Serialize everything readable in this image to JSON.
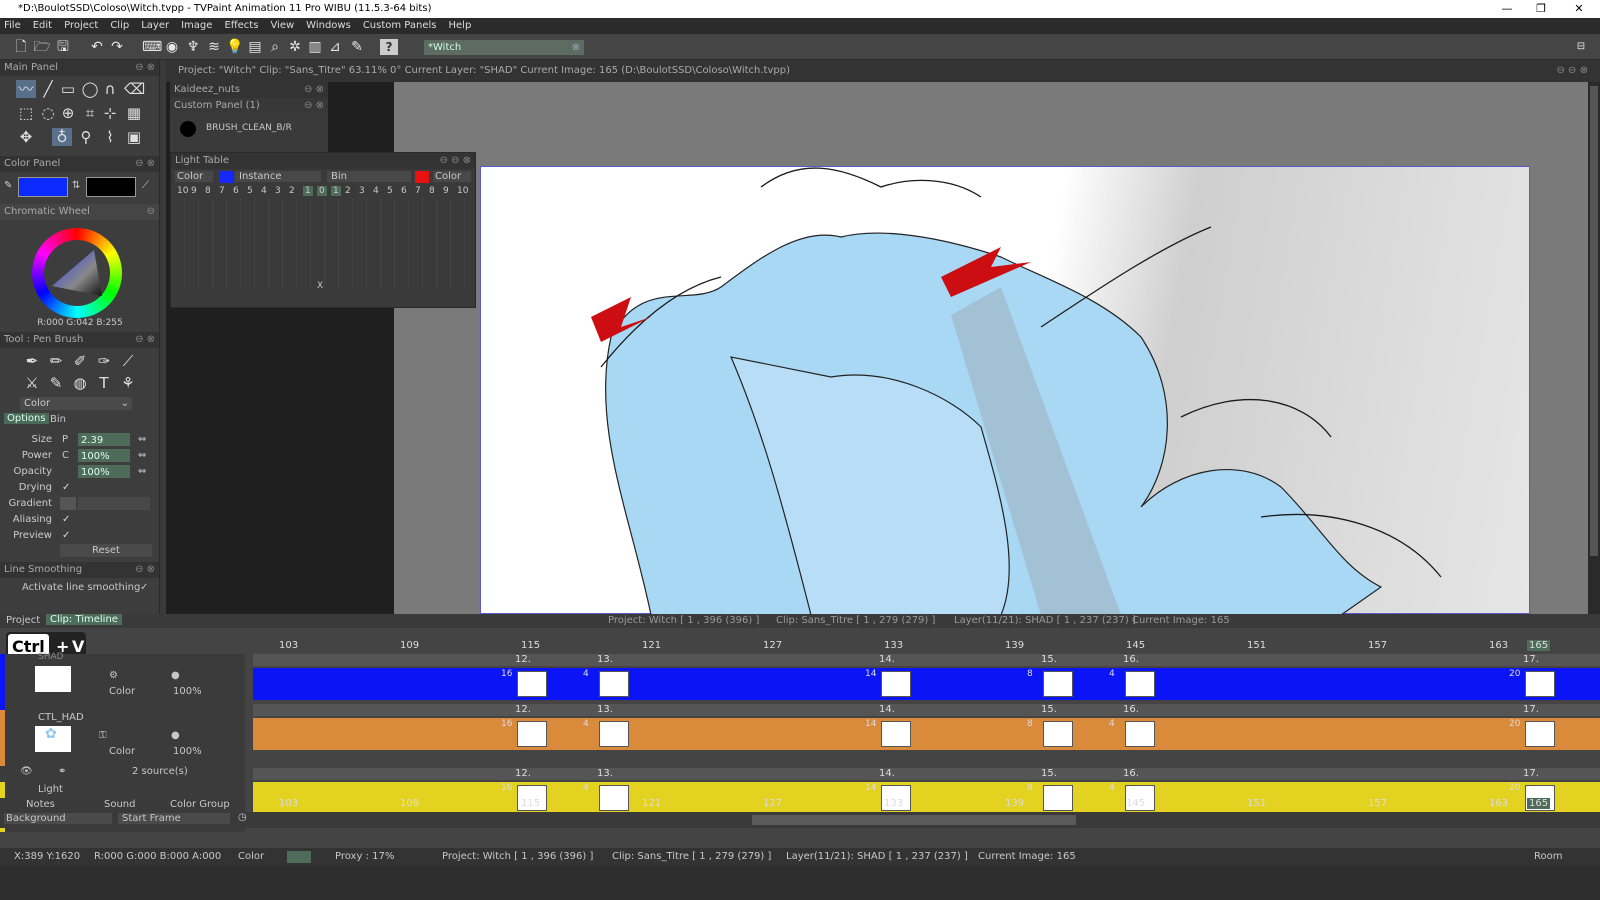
{
  "title_bar": {
    "title": "*D:\\BoulotSSD\\Coloso\\Witch.tvpp - TVPaint Animation 11 Pro WIBU (11.5.3-64 bits)"
  },
  "menu": [
    "File",
    "Edit",
    "Project",
    "Clip",
    "Layer",
    "Image",
    "Effects",
    "View",
    "Windows",
    "Custom Panels",
    "Help"
  ],
  "toolbar": {
    "doc_name": "*Witch",
    "help": "?"
  },
  "main_panel": {
    "title": "Main Panel"
  },
  "color_panel": {
    "title": "Color Panel",
    "wheel_title": "Chromatic Wheel",
    "rgb_readout": "R:000 G:042 B:255",
    "primary_color": "#0a2aff",
    "secondary_color": "#000000"
  },
  "tool_panel": {
    "title": "Tool : Pen Brush",
    "mode": "Color",
    "tabs": [
      "Options",
      "Bin"
    ],
    "rows": [
      {
        "label": "Size",
        "prefix": "P",
        "value": "2.39"
      },
      {
        "label": "Power",
        "prefix": "C",
        "value": "100%"
      },
      {
        "label": "Opacity",
        "prefix": "",
        "value": "100%"
      }
    ],
    "drying": "Drying",
    "gradient": "Gradient",
    "aliasing": "Aliasing",
    "preview": "Preview",
    "reset": "Reset"
  },
  "line_smoothing": {
    "title": "Line Smoothing",
    "option": "Activate line smoothing"
  },
  "info_line": "Project: \"Witch\"  Clip: \"Sans_Titre\"  63.11%  0°  Current Layer: \"SHAD\"  Current Image: 165 (D:\\BoulotSSD\\Coloso\\Witch.tvpp)",
  "custom_panels": {
    "name": "Kaideez_nuts",
    "panel": "Custom Panel (1)",
    "brush": "BRUSH_CLEAN_B/R"
  },
  "light_table": {
    "title": "Light Table",
    "left_mode": "Color",
    "instance": "Instance",
    "bin": "Bin",
    "right_mode": "Color",
    "left_color": "#1428ff",
    "right_color": "#e81010",
    "scale": [
      "10",
      "9",
      "8",
      "7",
      "6",
      "5",
      "4",
      "3",
      "2",
      "1",
      "0",
      "1",
      "2",
      "3",
      "4",
      "5",
      "6",
      "7",
      "8",
      "9",
      "10"
    ],
    "close_x": "X"
  },
  "timeline": {
    "tabs": [
      "Project",
      "Clip: Timeline"
    ],
    "header_info": [
      "Project: Witch [ 1 , 396  (396) ]",
      "Clip: Sans_Titre [ 1 , 279  (279) ]",
      "Layer(11/21): SHAD [ 1 , 237  (237) ]",
      "Current Image: 165"
    ],
    "ruler": [
      "103",
      "109",
      "115",
      "121",
      "127",
      "133",
      "139",
      "145",
      "151",
      "157",
      "163",
      "165"
    ],
    "shortcut": {
      "key": "Ctrl",
      "plus": "+",
      "letter": "V"
    },
    "layers": [
      {
        "name": "SHAD",
        "mode": "Color",
        "opacity": "100%",
        "color": "#0a14f5"
      },
      {
        "name": "CTL_HAD",
        "mode": "Color",
        "opacity": "100%",
        "sources": "2 source(s)",
        "color": "#d98a3a"
      },
      {
        "name": "Light",
        "mode": "",
        "opacity": "",
        "color": "#e3d21f"
      }
    ],
    "instance_labels": [
      "12.",
      "13.",
      "14.",
      "15.",
      "16.",
      "17."
    ],
    "lengths": [
      "16",
      "4",
      "14",
      "8",
      "4",
      "20"
    ],
    "bottom_tabs": [
      "Notes",
      "Sound",
      "Color Group"
    ],
    "background": "Background",
    "start_frame": "Start Frame"
  },
  "status_bar": {
    "coords": "X:389  Y:1620",
    "rgba": "R:000 G:000 B:000 A:000",
    "mode": "Color",
    "proxy": "Proxy : 17%",
    "project": "Project: Witch [ 1 , 396  (396) ]",
    "clip": "Clip: Sans_Titre [ 1 , 279  (279) ]",
    "layer": "Layer(11/21): SHAD [ 1 , 237  (237) ]",
    "current": "Current Image: 165",
    "room": "Room 1"
  }
}
